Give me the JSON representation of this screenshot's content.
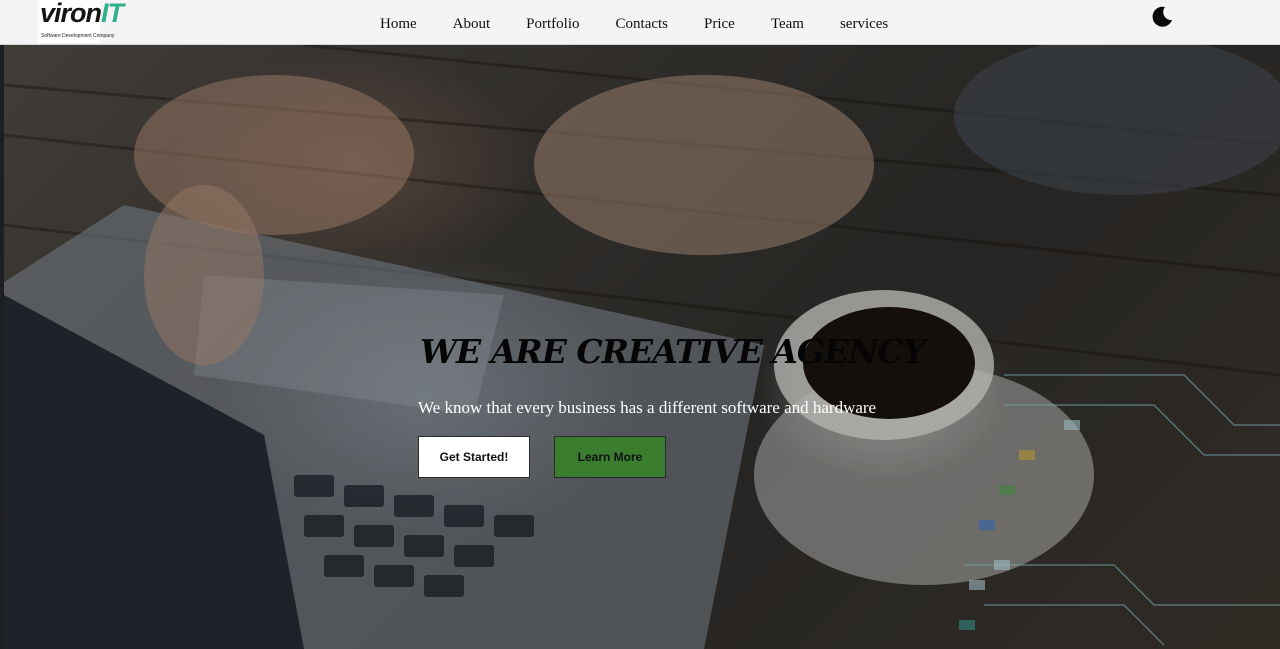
{
  "brand": {
    "logo_part1": "viron",
    "logo_part2": "IT",
    "tagline": "Software Development Company",
    "accent": "#2db08c"
  },
  "nav": {
    "items": [
      {
        "label": "Home"
      },
      {
        "label": "About"
      },
      {
        "label": "Portfolio"
      },
      {
        "label": "Contacts"
      },
      {
        "label": "Price"
      },
      {
        "label": "Team"
      },
      {
        "label": "services"
      }
    ],
    "theme_toggle_icon": "moon-icon"
  },
  "hero": {
    "title": "WE ARE CREATIVE AGENCY",
    "subtitle": "We know that every business has a different software and hardware",
    "primary_button": "Get Started!",
    "secondary_button": "Learn More",
    "secondary_button_color": "#3a7d2f"
  }
}
